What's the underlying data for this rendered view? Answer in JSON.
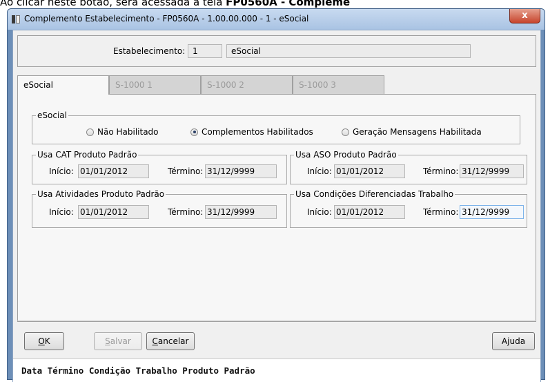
{
  "background_text": {
    "prefix": "Ao clicar neste botão, será acessada a tela ",
    "bold": "FP0560A - Compleme"
  },
  "window": {
    "title": "Complemento Estabelecimento - FP0560A - 1.00.00.000 - 1 - eSocial",
    "close_label": "x"
  },
  "header": {
    "estab_label": "Estabelecimento:",
    "estab_code": "1",
    "estab_name": "eSocial"
  },
  "tabs": [
    {
      "label": "eSocial",
      "active": true
    },
    {
      "label": "S-1000 1",
      "active": false
    },
    {
      "label": "S-1000 2",
      "active": false
    },
    {
      "label": "S-1000 3",
      "active": false
    }
  ],
  "esocial_group": {
    "title": "eSocial",
    "options": [
      {
        "label": "Não Habilitado",
        "checked": false
      },
      {
        "label": "Complementos Habilitados",
        "checked": true
      },
      {
        "label": "Geração Mensagens Habilitada",
        "checked": false
      }
    ]
  },
  "groups": [
    {
      "title": "Usa CAT Produto Padrão",
      "inicio_label": "Início:",
      "inicio": "01/01/2012",
      "termino_label": "Término:",
      "termino": "31/12/9999"
    },
    {
      "title": "Usa ASO Produto Padrão",
      "inicio_label": "Início:",
      "inicio": "01/01/2012",
      "termino_label": "Término:",
      "termino": "31/12/9999"
    },
    {
      "title": "Usa Atividades Produto Padrão",
      "inicio_label": "Início:",
      "inicio": "01/01/2012",
      "termino_label": "Término:",
      "termino": "31/12/9999"
    },
    {
      "title": "Usa Condições Diferenciadas Trabalho",
      "inicio_label": "Início:",
      "inicio": "01/01/2012",
      "termino_label": "Término:",
      "termino": "31/12/9999"
    }
  ],
  "buttons": {
    "ok": {
      "accel": "O",
      "rest": "K"
    },
    "salvar": {
      "accel": "S",
      "rest": "alvar"
    },
    "cancelar": {
      "accel": "C",
      "rest": "ancelar"
    },
    "ajuda": {
      "pre": "A",
      "accel": "j",
      "rest": "uda"
    }
  },
  "status": "Data Término Condição Trabalho Produto Padrão"
}
